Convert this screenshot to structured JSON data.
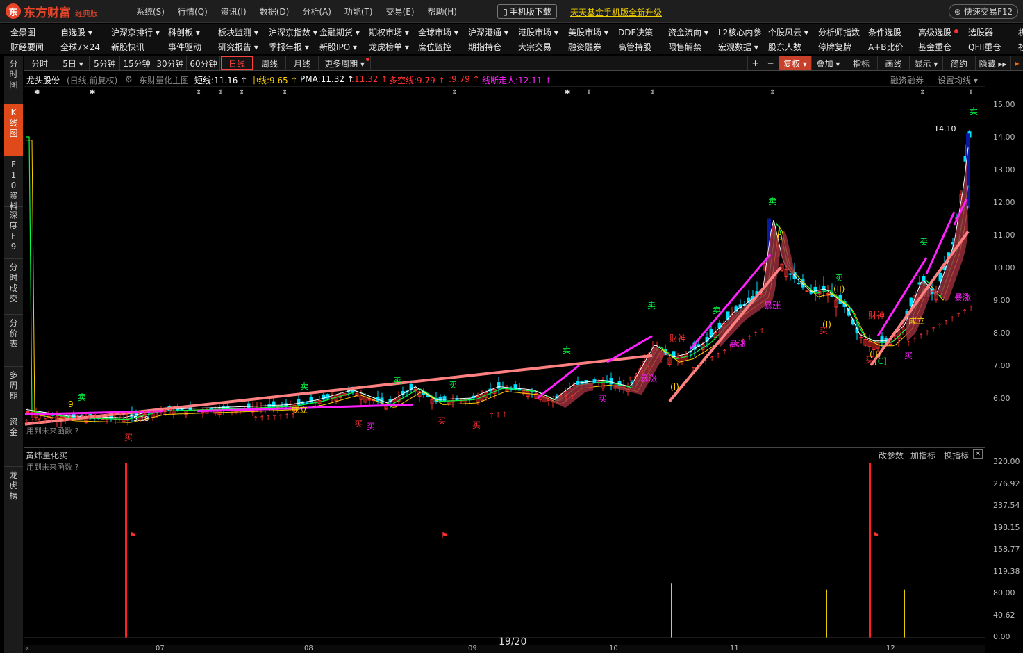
{
  "brand": {
    "name": "东方财富",
    "edition": "经典版",
    "logo_glyph": "东"
  },
  "menus": [
    "系统(S)",
    "行情(Q)",
    "资讯(I)",
    "数据(D)",
    "分析(A)",
    "功能(T)",
    "交易(E)",
    "帮助(H)"
  ],
  "header": {
    "mobile_download": "手机版下载",
    "fund_link": "天天基金手机版全新升级",
    "quick_trade": "快速交易F12"
  },
  "nav_row1": [
    "全景图",
    "自选股 ▾",
    "沪深京排行 ▾",
    "科创板 ▾",
    "板块监测 ▾",
    "沪深京指数 ▾",
    "金融期货 ▾",
    "期权市场 ▾",
    "全球市场 ▾",
    "沪深港通 ▾",
    "港股市场 ▾",
    "美股市场 ▾",
    "DDE决策",
    "资金流向 ▾",
    "L2核心内参",
    "个股风云 ▾",
    "分析师指数",
    "条件选股",
    "高级选股",
    "选股器",
    "机"
  ],
  "nav_row2": [
    "财经要闻",
    "全球7×24",
    "新股快讯",
    "事件驱动",
    "研究报告 ▾",
    "季报年报 ▾",
    "新股IPO ▾",
    "龙虎榜单 ▾",
    "席位监控",
    "期指持仓",
    "大宗交易",
    "融资融券",
    "高管持股",
    "限售解禁",
    "宏观数据 ▾",
    "股东人数",
    "停牌复牌",
    "A+B比价",
    "基金重仓",
    "QFII重仓",
    "社"
  ],
  "left_tabs": [
    {
      "label": "分时图"
    },
    {
      "label": "K线图",
      "active": true
    },
    {
      "label": "F10资料"
    },
    {
      "label": "深度F9"
    },
    {
      "label": "分时成交"
    },
    {
      "label": "分价表"
    },
    {
      "label": "多周期"
    },
    {
      "label": "资金"
    },
    {
      "label": "龙虎榜"
    }
  ],
  "periods": [
    "分时",
    "5日 ▾",
    "5分钟",
    "15分钟",
    "30分钟",
    "60分钟",
    "日线",
    "周线",
    "月线",
    "更多周期 ▾"
  ],
  "active_period": "日线",
  "toolbar": {
    "plus": "+",
    "minus": "−",
    "fq": "复权 ▾",
    "overlay": "叠加 ▾",
    "indicator": "指标",
    "draw": "画线",
    "display": "显示 ▾",
    "simple": "简约",
    "hide": "隐藏 ▸▸"
  },
  "info": {
    "stock": "龙头股份",
    "mode": "(日线,前复权)",
    "indicator": "东财量化主图",
    "short": "短线:11.16 ↑",
    "mid": "中线:9.65 ↑",
    "pma": "PMA:11.32 ↑",
    "pma2": ":11.32 ↑",
    "duokong": "多空线:9.79 ↑",
    "dk2": ":9.79 ↑",
    "trend": "线断走人:12.11 ↑",
    "margin": "融资融券",
    "setma": "设置均线 ▾"
  },
  "main_axis": [
    "15.00",
    "14.00",
    "13.00",
    "12.00",
    "11.00",
    "10.00",
    "9.00",
    "8.00",
    "7.00",
    "6.00"
  ],
  "annotations": {
    "high": "14.10",
    "low": "5.18",
    "future_func": "用到未来函数 ?"
  },
  "sub": {
    "title": "黄炜量化买",
    "future_func": "用到未来函数 ?",
    "change_param": "改参数",
    "add_ind": "加指标",
    "swap_ind": "换指标",
    "close": "✕"
  },
  "sub_axis": [
    "320.00",
    "276.92",
    "237.54",
    "198.15",
    "158.77",
    "119.38",
    "80.00",
    "40.62",
    "0.00"
  ],
  "x_labels": [
    "07",
    "08",
    "09",
    "10",
    "11",
    "12"
  ],
  "pager": "19/20",
  "colors": {
    "accent": "#e04a1a",
    "up": "#ff3030",
    "down": "#00e0ff",
    "ma_short": "#ffffff",
    "ma_mid": "#ffd000",
    "ma_long": "#00ff40",
    "trend": "#ff20ff",
    "pink": "#ff8080"
  }
}
